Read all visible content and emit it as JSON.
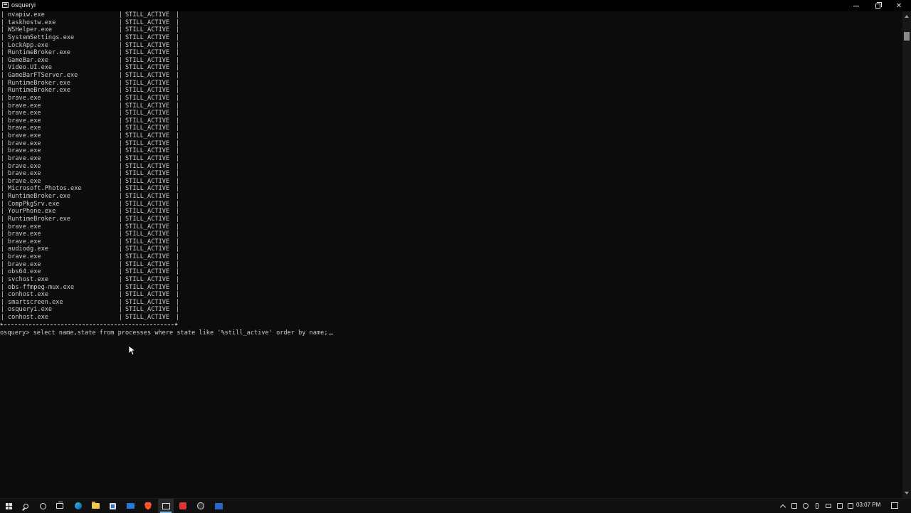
{
  "window": {
    "title": "osqueryi"
  },
  "console": {
    "rows": [
      {
        "name": "nvapiw.exe",
        "state": "STILL_ACTIVE"
      },
      {
        "name": "taskhostw.exe",
        "state": "STILL_ACTIVE"
      },
      {
        "name": "WSHelper.exe",
        "state": "STILL_ACTIVE"
      },
      {
        "name": "SystemSettings.exe",
        "state": "STILL_ACTIVE"
      },
      {
        "name": "LockApp.exe",
        "state": "STILL_ACTIVE"
      },
      {
        "name": "RuntimeBroker.exe",
        "state": "STILL_ACTIVE"
      },
      {
        "name": "GameBar.exe",
        "state": "STILL_ACTIVE"
      },
      {
        "name": "Video.UI.exe",
        "state": "STILL_ACTIVE"
      },
      {
        "name": "GameBarFTServer.exe",
        "state": "STILL_ACTIVE"
      },
      {
        "name": "RuntimeBroker.exe",
        "state": "STILL_ACTIVE"
      },
      {
        "name": "RuntimeBroker.exe",
        "state": "STILL_ACTIVE"
      },
      {
        "name": "brave.exe",
        "state": "STILL_ACTIVE"
      },
      {
        "name": "brave.exe",
        "state": "STILL_ACTIVE"
      },
      {
        "name": "brave.exe",
        "state": "STILL_ACTIVE"
      },
      {
        "name": "brave.exe",
        "state": "STILL_ACTIVE"
      },
      {
        "name": "brave.exe",
        "state": "STILL_ACTIVE"
      },
      {
        "name": "brave.exe",
        "state": "STILL_ACTIVE"
      },
      {
        "name": "brave.exe",
        "state": "STILL_ACTIVE"
      },
      {
        "name": "brave.exe",
        "state": "STILL_ACTIVE"
      },
      {
        "name": "brave.exe",
        "state": "STILL_ACTIVE"
      },
      {
        "name": "brave.exe",
        "state": "STILL_ACTIVE"
      },
      {
        "name": "brave.exe",
        "state": "STILL_ACTIVE"
      },
      {
        "name": "brave.exe",
        "state": "STILL_ACTIVE"
      },
      {
        "name": "Microsoft.Photos.exe",
        "state": "STILL_ACTIVE"
      },
      {
        "name": "RuntimeBroker.exe",
        "state": "STILL_ACTIVE"
      },
      {
        "name": "CompPkgSrv.exe",
        "state": "STILL_ACTIVE"
      },
      {
        "name": "YourPhone.exe",
        "state": "STILL_ACTIVE"
      },
      {
        "name": "RuntimeBroker.exe",
        "state": "STILL_ACTIVE"
      },
      {
        "name": "brave.exe",
        "state": "STILL_ACTIVE"
      },
      {
        "name": "brave.exe",
        "state": "STILL_ACTIVE"
      },
      {
        "name": "brave.exe",
        "state": "STILL_ACTIVE"
      },
      {
        "name": "audiodg.exe",
        "state": "STILL_ACTIVE"
      },
      {
        "name": "brave.exe",
        "state": "STILL_ACTIVE"
      },
      {
        "name": "brave.exe",
        "state": "STILL_ACTIVE"
      },
      {
        "name": "obs64.exe",
        "state": "STILL_ACTIVE"
      },
      {
        "name": "svchost.exe",
        "state": "STILL_ACTIVE"
      },
      {
        "name": "obs-ffmpeg-mux.exe",
        "state": "STILL_ACTIVE"
      },
      {
        "name": "conhost.exe",
        "state": "STILL_ACTIVE"
      },
      {
        "name": "smartscreen.exe",
        "state": "STILL_ACTIVE"
      },
      {
        "name": "osqueryi.exe",
        "state": "STILL_ACTIVE"
      },
      {
        "name": "conhost.exe",
        "state": "STILL_ACTIVE"
      }
    ],
    "prompt": "osquery>",
    "command": "select name,state from processes where state like '%still_active' order by name;"
  },
  "taskbar": {
    "icons": [
      "windows-start-icon",
      "search-icon",
      "cortana-icon",
      "task-view-icon",
      "edge-icon",
      "file-explorer-icon",
      "store-icon",
      "mail-icon",
      "brave-icon",
      "terminal-icon",
      "red-app-icon",
      "obs-icon",
      "powershell-icon"
    ],
    "active_icon": "terminal-icon",
    "clock": "03:07 PM"
  }
}
